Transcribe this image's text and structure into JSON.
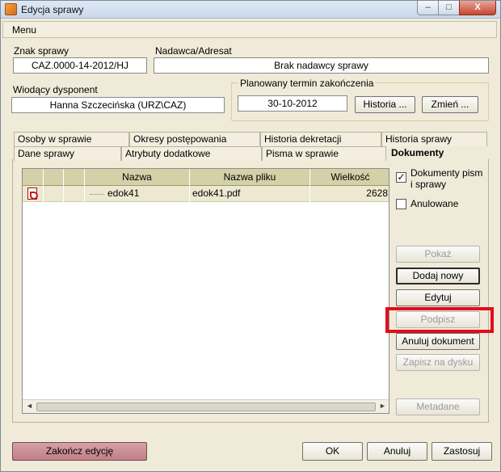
{
  "window": {
    "title": "Edycja sprawy",
    "minimize": "–",
    "maximize": "□",
    "close": "X"
  },
  "menu": {
    "label": "Menu"
  },
  "case_number": {
    "label": "Znak sprawy",
    "value": "CAZ.0000-14-2012/HJ"
  },
  "sender": {
    "label": "Nadawca/Adresat",
    "value": "Brak nadawcy sprawy"
  },
  "dispatcher": {
    "label": "Wiodący dysponent",
    "value": "Hanna Szczecińska (URZ\\CAZ)"
  },
  "planned_end": {
    "label": "Planowany termin zakończenia",
    "value": "30-10-2012",
    "history_button": "Historia ...",
    "change_button": "Zmień ..."
  },
  "tabs_row1": [
    "Osoby w sprawie",
    "Okresy postępowania",
    "Historia dekretacji",
    "Historia sprawy"
  ],
  "tabs_row2": [
    "Dane sprawy",
    "Atrybuty dodatkowe",
    "Pisma w sprawie",
    "Dokumenty"
  ],
  "grid": {
    "columns": [
      "Nazwa",
      "Nazwa pliku",
      "Wielkość"
    ],
    "rows": [
      {
        "name": "edok41",
        "file": "edok41.pdf",
        "size": "2628"
      }
    ],
    "scroll_left": "◄",
    "scroll_right": "►"
  },
  "options": {
    "docs_label": "Dokumenty pism i sprawy",
    "docs_checked": "✓",
    "cancelled_label": "Anulowane"
  },
  "actions": {
    "show": "Pokaż",
    "add_new": "Dodaj nowy",
    "edit": "Edytuj",
    "sign": "Podpisz",
    "cancel_doc": "Anuluj dokument",
    "save_disk": "Zapisz na dysku",
    "metadata": "Metadane"
  },
  "footer": {
    "finish": "Zakończ edycję",
    "ok": "OK",
    "cancel": "Anuluj",
    "apply": "Zastosuj"
  },
  "colors": {
    "highlight": "#e00d1c",
    "finish_button": "#c8888f",
    "grid_header": "#d4d0a8"
  }
}
